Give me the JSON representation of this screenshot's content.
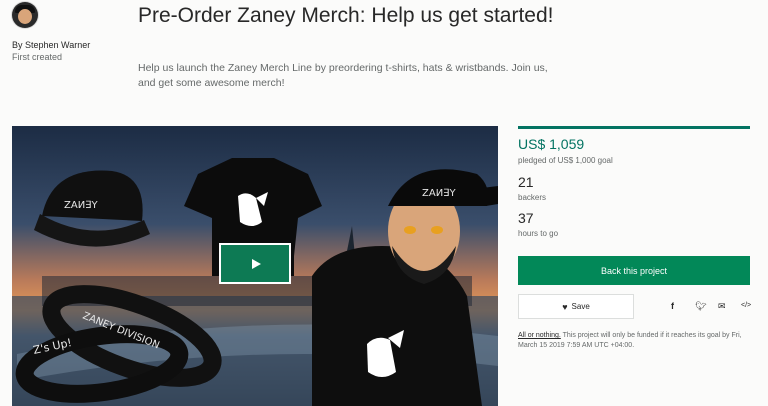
{
  "creator": {
    "byline": "By Stephen Warner",
    "status": "First created"
  },
  "project": {
    "title": "Pre-Order Zaney Merch: Help us get started!",
    "blurb": "Help us launch the Zaney Merch Line by preordering t-shirts, hats & wristbands. Join us, and get some awesome merch!"
  },
  "video": {
    "hat_text": "ZAИ∃Y",
    "shirt_brand": "ZAИ∃Y",
    "band1_text": "ZANEY DIVISION",
    "band2_text": "Z's Up!",
    "play_icon": "play-icon"
  },
  "stats": {
    "pledged": "US$ 1,059",
    "goal": "pledged of US$ 1,000 goal",
    "backers": "21",
    "backers_label": "backers",
    "hours": "37",
    "hours_label": "hours to go"
  },
  "actions": {
    "back_label": "Back this project",
    "save_label": "Save",
    "share_icons": [
      "facebook-icon",
      "twitter-icon",
      "email-icon",
      "embed-icon"
    ]
  },
  "funding_note": {
    "link": "All or nothing.",
    "text": " This project will only be funded if it reaches its goal by Fri, March 15 2019 7:59 AM UTC +04:00."
  },
  "colors": {
    "accent": "#037362",
    "button": "#028858"
  }
}
